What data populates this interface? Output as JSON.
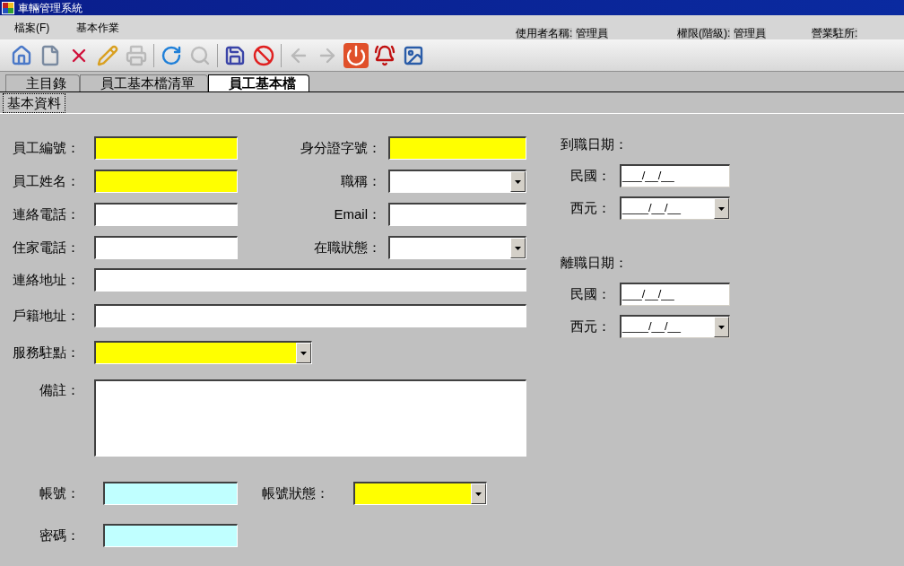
{
  "window": {
    "title": "車輛管理系統"
  },
  "menu": [
    "檔案(F)",
    "基本作業"
  ],
  "user_info": [
    {
      "label": "使用者名稱:",
      "value": "管理員"
    },
    {
      "label": "權限(階級):",
      "value": "管理員"
    },
    {
      "label": "營業駐所:"
    }
  ],
  "toolbar": [
    {
      "kind": "home",
      "disabled": false
    },
    {
      "kind": "new",
      "disabled": false
    },
    {
      "kind": "delete",
      "disabled": false
    },
    {
      "kind": "edit",
      "disabled": false
    },
    {
      "kind": "print",
      "disabled": true
    },
    {
      "kind": "separator"
    },
    {
      "kind": "refresh",
      "disabled": false
    },
    {
      "kind": "search",
      "disabled": true
    },
    {
      "kind": "separator"
    },
    {
      "kind": "save",
      "disabled": false
    },
    {
      "kind": "cancel",
      "disabled": false
    },
    {
      "kind": "separator"
    },
    {
      "kind": "back",
      "disabled": true
    },
    {
      "kind": "forward",
      "disabled": true
    },
    {
      "kind": "power",
      "disabled": false
    },
    {
      "kind": "alarm",
      "disabled": false
    },
    {
      "kind": "image",
      "disabled": false
    }
  ],
  "tabs": [
    {
      "label": "主目錄",
      "selected": false
    },
    {
      "label": "員工基本檔清單",
      "selected": false
    },
    {
      "label": "員工基本檔",
      "selected": true
    }
  ],
  "subtabs": [
    {
      "label": "基本資料",
      "selected": true
    }
  ],
  "form": {
    "grid_fields": [
      {
        "label": "員工編號：",
        "kind": "text",
        "color": "#ffff00"
      },
      {
        "label": "身分證字號：",
        "kind": "text",
        "color": "#ffff00"
      },
      {
        "label": "員工姓名：",
        "kind": "text",
        "color": "#ffff00"
      },
      {
        "label": "職稱：",
        "kind": "combo",
        "color": "#ffffff"
      },
      {
        "label": "連絡電話：",
        "kind": "text",
        "color": "#ffffff"
      },
      {
        "label": "Email：",
        "kind": "text",
        "color": "#ffffff"
      },
      {
        "label": "住家電話：",
        "kind": "text",
        "color": "#ffffff"
      },
      {
        "label": "在職狀態：",
        "kind": "combo",
        "color": "#ffffff"
      }
    ],
    "wide_fields": [
      {
        "label": "連絡地址：",
        "kind": "text",
        "color": "#ffffff"
      },
      {
        "label": "戶籍地址：",
        "kind": "text",
        "color": "#ffffff"
      }
    ],
    "service_point": {
      "label": "服務駐點：",
      "kind": "combo",
      "color": "#ffff00"
    },
    "remarks": {
      "label": "備註："
    },
    "account": {
      "label": "帳號：",
      "kind": "text",
      "color": "#c0ffff"
    },
    "account_status": {
      "label": "帳號狀態：",
      "kind": "combo",
      "color": "#ffff00"
    },
    "password": {
      "label": "密碼：",
      "kind": "text",
      "color": "#c0ffff"
    },
    "dates": [
      {
        "title": "到職日期：",
        "roc": {
          "label": "民國：",
          "value": "___/__/__"
        },
        "ad": {
          "label": "西元：",
          "value": "____/__/__"
        }
      },
      {
        "title": "離職日期：",
        "roc": {
          "label": "民國：",
          "value": "___/__/__"
        },
        "ad": {
          "label": "西元：",
          "value": "____/__/__"
        }
      }
    ]
  }
}
